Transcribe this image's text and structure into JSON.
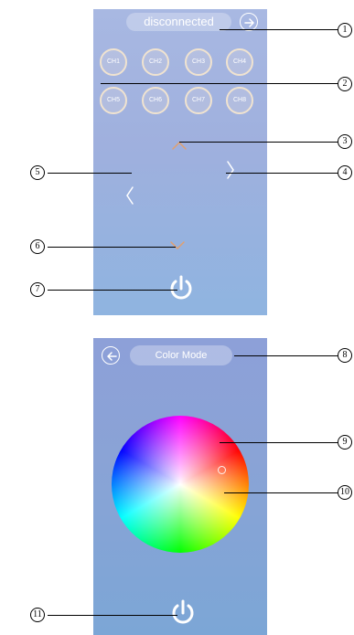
{
  "screen_main": {
    "status": "disconnected",
    "channels_top": [
      "CH1",
      "CH2",
      "CH3",
      "CH4"
    ],
    "channels_bottom": [
      "CH5",
      "CH6",
      "CH7",
      "CH8"
    ]
  },
  "screen_color": {
    "mode_title": "Color Mode"
  },
  "callouts": {
    "c1": "1",
    "c2": "2",
    "c3": "3",
    "c4": "4",
    "c5": "5",
    "c6": "6",
    "c7": "7",
    "c8": "8",
    "c9": "9",
    "c10": "10",
    "c11": "11"
  },
  "colors": {
    "arrow_up": "#e0a070",
    "arrow_other": "#ffffff",
    "channel_ring": "#f0e3d0"
  }
}
